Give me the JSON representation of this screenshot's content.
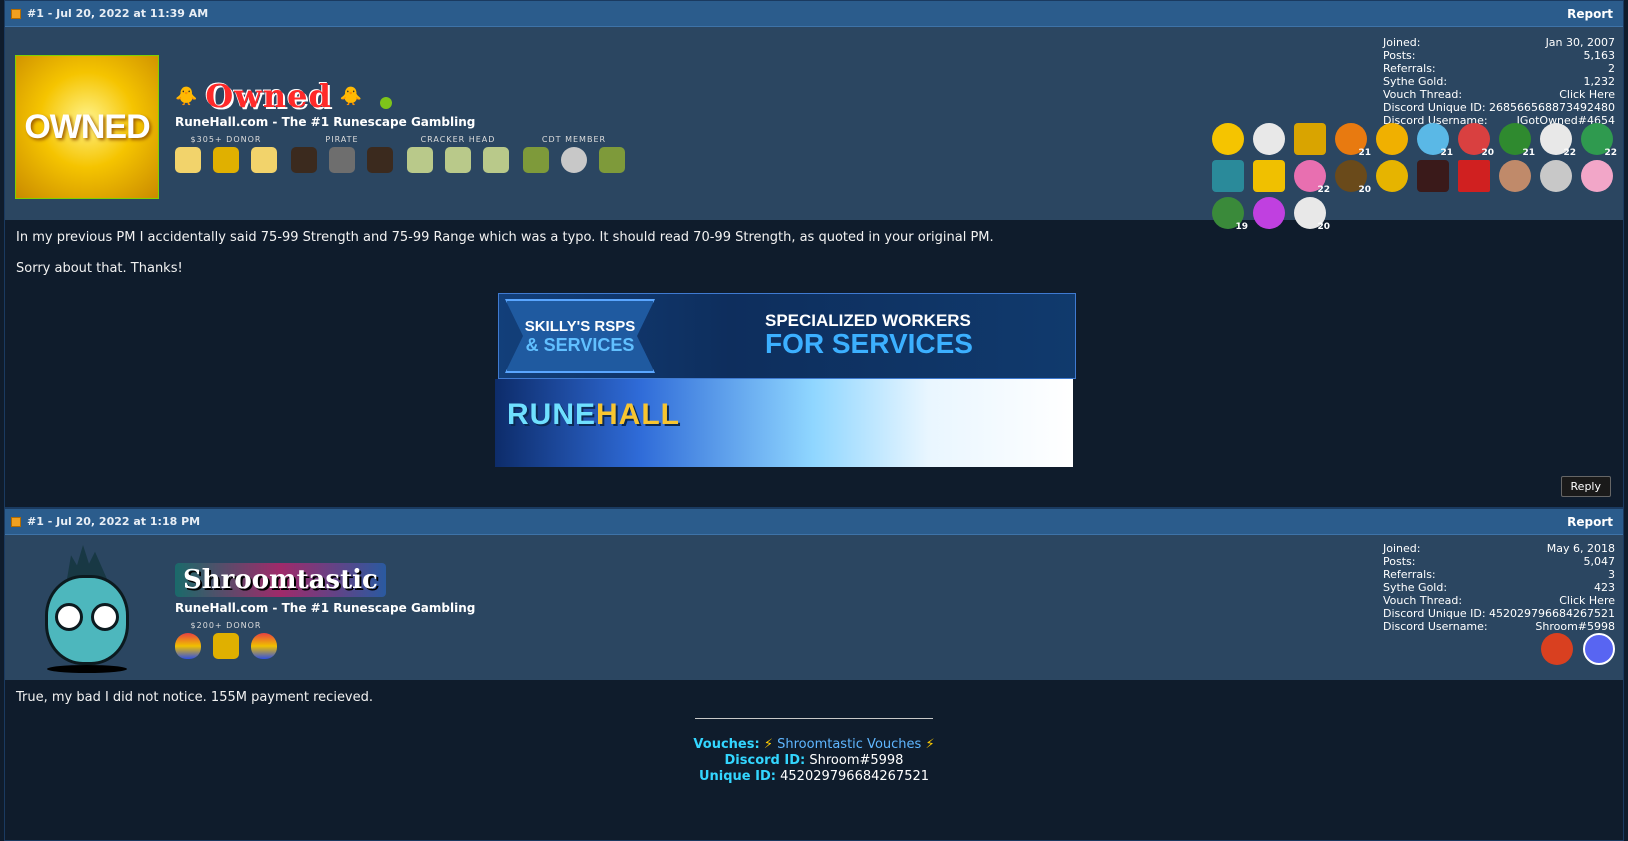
{
  "posts": [
    {
      "header": {
        "meta": "#1 - Jul 20, 2022 at 11:39 AM",
        "report_label": "Report"
      },
      "user": {
        "avatar_text": "OWNED",
        "name": "Owned",
        "title": "RuneHall.com - The #1 Runescape Gambling",
        "award_labels": [
          "$305+ DONOR",
          "PIRATE",
          "CRACKER HEAD",
          "CDT MEMBER"
        ],
        "stats": [
          {
            "label": "Joined:",
            "value": "Jan 30, 2007"
          },
          {
            "label": "Posts:",
            "value": "5,163"
          },
          {
            "label": "Referrals:",
            "value": "2"
          },
          {
            "label": "Sythe Gold:",
            "value": "1,232"
          },
          {
            "label": "Vouch Thread:",
            "value": "Click Here"
          },
          {
            "label": "Discord Unique ID:",
            "value": "268566568873492480"
          },
          {
            "label": "Discord Username:",
            "value": "IGotOwned#4654"
          }
        ],
        "badge_counts": [
          "",
          "",
          "",
          "21",
          "",
          "21",
          "20",
          "21",
          "22",
          "22",
          "",
          "",
          "22",
          "20",
          "",
          "",
          "",
          "",
          "",
          "",
          "19",
          "",
          "20"
        ]
      },
      "body": {
        "lines": [
          "In my previous PM I accidentally said 75-99 Strength and 75-99 Range which was a typo. It should read 70-99 Strength, as quoted in your original PM.",
          "Sorry about that. Thanks!"
        ],
        "banner1": {
          "left_line1": "SKILLY'S RSPS",
          "left_line2": "& SERVICES",
          "right_line1": "SPECIALIZED WORKERS",
          "right_line2": "FOR SERVICES"
        },
        "banner2": {
          "part1": "RUNE",
          "part2": "HALL"
        },
        "reply_label": "Reply"
      }
    },
    {
      "header": {
        "meta": "#1 - Jul 20, 2022 at 1:18 PM",
        "report_label": "Report"
      },
      "user": {
        "name": "Shroomtastic",
        "title": "RuneHall.com - The #1 Runescape Gambling",
        "award_labels": [
          "$200+ DONOR"
        ],
        "stats": [
          {
            "label": "Joined:",
            "value": "May 6, 2018"
          },
          {
            "label": "Posts:",
            "value": "5,047"
          },
          {
            "label": "Referrals:",
            "value": "3"
          },
          {
            "label": "Sythe Gold:",
            "value": "423"
          },
          {
            "label": "Vouch Thread:",
            "value": "Click Here"
          },
          {
            "label": "Discord Unique ID:",
            "value": "452029796684267521"
          },
          {
            "label": "Discord Username:",
            "value": "Shroom#5998"
          }
        ]
      },
      "body": {
        "lines": [
          "True, my bad I did not notice. 155M payment recieved."
        ],
        "signature": {
          "vouches_label": "Vouches:",
          "vouches_link": "Shroomtastic Vouches",
          "discord_label": "Discord ID:",
          "discord_value": "Shroom#5998",
          "unique_label": "Unique ID:",
          "unique_value": "452029796684267521"
        }
      }
    }
  ],
  "colors": {
    "header_bar": "#2b5c8c",
    "user_bar": "#2b4661",
    "post_body": "#0f1c2c",
    "sig_key": "#33d6ff"
  }
}
